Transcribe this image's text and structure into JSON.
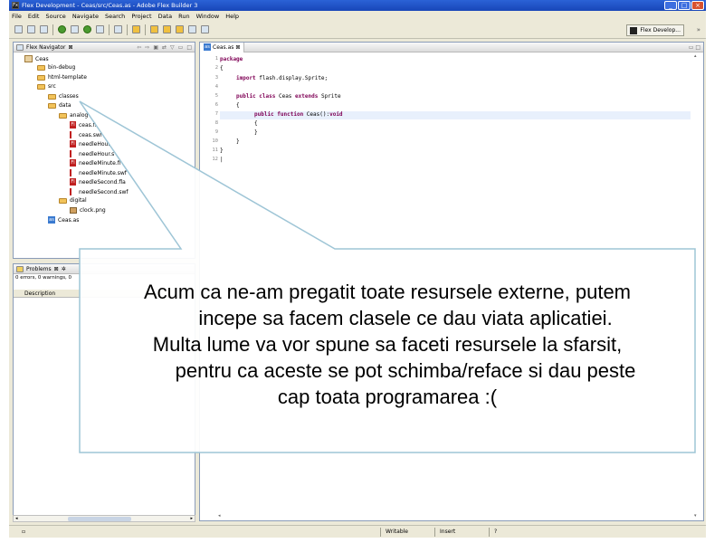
{
  "window": {
    "title": "Flex Development - Ceas/src/Ceas.as - Adobe Flex Builder 3",
    "app_icon": "Fx"
  },
  "menu": [
    "File",
    "Edit",
    "Source",
    "Navigate",
    "Search",
    "Project",
    "Data",
    "Run",
    "Window",
    "Help"
  ],
  "perspective_label": "Flex Develop...",
  "navigator": {
    "title": "Flex Navigator",
    "items": [
      {
        "label": "Ceas",
        "icon": "project-icon"
      },
      {
        "label": "bin-debug",
        "icon": "folder-icon"
      },
      {
        "label": "html-template",
        "icon": "folder-icon"
      },
      {
        "label": "src",
        "icon": "folder-icon"
      },
      {
        "label": "classes",
        "icon": "folder-icon"
      },
      {
        "label": "data",
        "icon": "folder-icon"
      },
      {
        "label": "analog",
        "icon": "folder-icon"
      },
      {
        "label": "ceas.fl",
        "icon": "fla-icon"
      },
      {
        "label": "ceas.swf",
        "icon": "swf-icon"
      },
      {
        "label": "needleHour",
        "icon": "fla-icon"
      },
      {
        "label": "needleHour.s",
        "icon": "swf-icon"
      },
      {
        "label": "needleMinute.fl",
        "icon": "fla-icon"
      },
      {
        "label": "needleMinute.swf",
        "icon": "swf-icon"
      },
      {
        "label": "needleSecond.fla",
        "icon": "fla-icon"
      },
      {
        "label": "needleSecond.swf",
        "icon": "swf-icon"
      },
      {
        "label": "digital",
        "icon": "folder-icon"
      },
      {
        "label": "clock.png",
        "icon": "png-icon"
      },
      {
        "label": "Ceas.as",
        "icon": "as-file-icon"
      }
    ]
  },
  "problems": {
    "title": "Problems",
    "status": "0 errors, 0 warnings, 0",
    "column": "Description"
  },
  "editor": {
    "tab_label": "Ceas.as",
    "line_numbers": [
      "1",
      "2",
      "3",
      "4",
      "5",
      "6",
      "7",
      "8",
      "9",
      "10",
      "11",
      "12"
    ],
    "lines": [
      {
        "kw": "package",
        "rest": ""
      },
      {
        "kw": "",
        "rest": "{"
      },
      {
        "kw": "import",
        "rest": " flash.display.Sprite;"
      },
      {
        "kw": "",
        "rest": ""
      },
      {
        "kw": "public class",
        "rest": " Ceas ",
        "kw2": "extends",
        "rest2": " Sprite"
      },
      {
        "kw": "",
        "rest": "{"
      },
      {
        "kw": "public function",
        "rest": " Ceas():",
        "kw2": "void",
        "rest2": ""
      },
      {
        "kw": "",
        "rest": "{"
      },
      {
        "kw": "",
        "rest": "}"
      },
      {
        "kw": "",
        "rest": "}"
      },
      {
        "kw": "",
        "rest": "}"
      },
      {
        "kw": "",
        "rest": "|"
      }
    ]
  },
  "status": {
    "writable": "Writable",
    "insert": "Insert",
    "position": "?"
  },
  "callout": {
    "lines": [
      "Acum ca ne-am pregatit toate resursele externe, putem",
      "incepe sa facem clasele ce dau viata aplicatiei.",
      "Multa lume va vor spune sa faceti resursele la sfarsit,",
      "pentru ca aceste se pot schimba/reface si dau peste",
      "cap toata programarea :("
    ]
  }
}
